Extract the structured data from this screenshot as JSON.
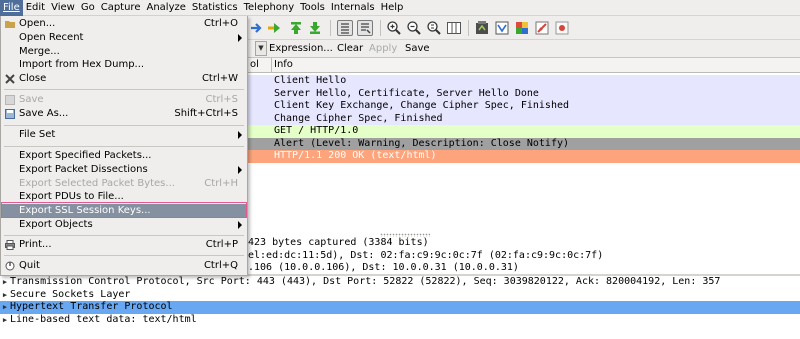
{
  "menubar": [
    "File",
    "Edit",
    "View",
    "Go",
    "Capture",
    "Analyze",
    "Statistics",
    "Telephony",
    "Tools",
    "Internals",
    "Help"
  ],
  "file_menu": {
    "items": [
      {
        "label": "Open...",
        "shortcut": "Ctrl+O"
      },
      {
        "label": "Open Recent",
        "submenu": true
      },
      {
        "label": "Merge..."
      },
      {
        "label": "Import from Hex Dump..."
      },
      {
        "label": "Close",
        "shortcut": "Ctrl+W"
      },
      {
        "label": "Save",
        "shortcut": "Ctrl+S",
        "disabled": true
      },
      {
        "label": "Save As...",
        "shortcut": "Shift+Ctrl+S"
      },
      {
        "label": "File Set",
        "submenu": true
      },
      {
        "label": "Export Specified Packets..."
      },
      {
        "label": "Export Packet Dissections",
        "submenu": true
      },
      {
        "label": "Export Selected Packet Bytes...",
        "shortcut": "Ctrl+H",
        "disabled": true
      },
      {
        "label": "Export PDUs to File..."
      },
      {
        "label": "Export SSL Session Keys...",
        "highlighted": true
      },
      {
        "label": "Export Objects",
        "submenu": true
      },
      {
        "label": "Print...",
        "shortcut": "Ctrl+P"
      },
      {
        "label": "Quit",
        "shortcut": "Ctrl+Q"
      }
    ]
  },
  "filter_bar": {
    "expression": "Expression...",
    "clear": "Clear",
    "apply": "Apply",
    "save": "Save"
  },
  "packet_list": {
    "columns": [
      "ol",
      "Info"
    ],
    "rows": [
      {
        "info": "Client Hello",
        "color": "#e7e6ff"
      },
      {
        "info": "Server Hello, Certificate, Server Hello Done",
        "color": "#e7e6ff"
      },
      {
        "info": "Client Key Exchange, Change Cipher Spec, Finished",
        "color": "#e7e6ff"
      },
      {
        "info": "Change Cipher Spec, Finished",
        "color": "#e7e6ff"
      },
      {
        "info": "GET / HTTP/1.0",
        "color": "#e4ffc7"
      },
      {
        "info": "Alert (Level: Warning, Description: Close Notify)",
        "color": "#a0a0a0"
      },
      {
        "info": "HTTP/1.1 200 OK  (text/html)",
        "color": "#fda47c",
        "text_color": "#ffffff"
      }
    ]
  },
  "details": {
    "partial_lines": [
      " 423 bytes captured (3384 bits)",
      "el:ed:dc:11:5d), Dst: 02:fa:c9:9c:0c:7f (02:fa:c9:9c:0c:7f)",
      ".106 (10.0.0.106), Dst: 10.0.0.31 (10.0.0.31)"
    ],
    "tree": [
      {
        "label": "Transmission Control Protocol, Src Port: 443 (443), Dst Port: 52822 (52822), Seq: 3039820122, Ack: 820004192, Len: 357"
      },
      {
        "label": "Secure Sockets Layer"
      },
      {
        "label": "Hypertext Transfer Protocol",
        "selected": true
      },
      {
        "label": "Line-based text data: text/html"
      }
    ]
  },
  "colors": {
    "menu_highlight": "#8591a0",
    "highlight_border": "#e25a8f",
    "selected_row": "#68a7f2"
  }
}
